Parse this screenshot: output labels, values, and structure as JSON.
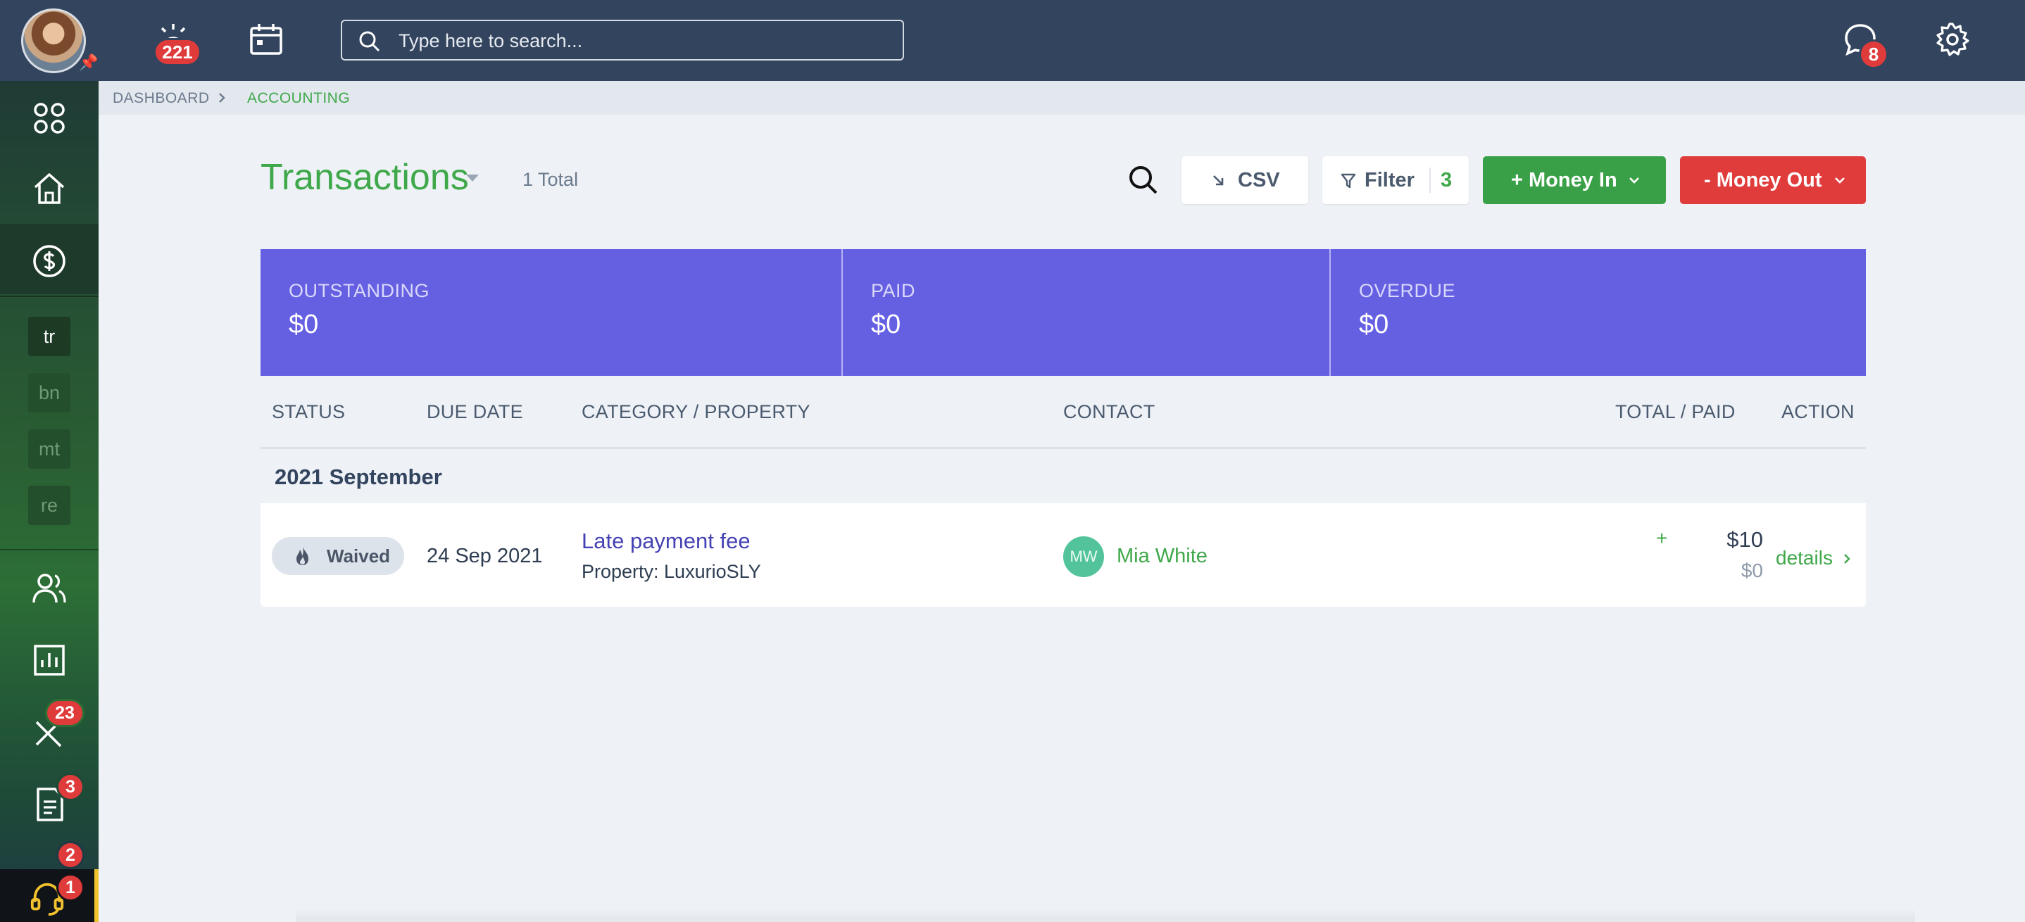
{
  "topbar": {
    "alerts_count": "221",
    "messages_count": "8",
    "search_placeholder": "Type here to search..."
  },
  "sidebar": {
    "mini_items": [
      "tr",
      "bn",
      "mt",
      "re"
    ],
    "maintenance_count": "23",
    "documents_count": "3",
    "extra_count": "2",
    "support_count": "1"
  },
  "breadcrumb": {
    "root": "DASHBOARD",
    "current": "ACCOUNTING"
  },
  "header": {
    "title": "Transactions",
    "total": "1 Total",
    "csv_label": "CSV",
    "filter_label": "Filter",
    "filter_count": "3",
    "money_in_label": "+ Money In",
    "money_out_label": "- Money Out"
  },
  "summary": {
    "outstanding_label": "OUTSTANDING",
    "outstanding_value": "$0",
    "paid_label": "PAID",
    "paid_value": "$0",
    "overdue_label": "OVERDUE",
    "overdue_value": "$0"
  },
  "table": {
    "columns": {
      "status": "STATUS",
      "due_date": "DUE DATE",
      "category": "CATEGORY / PROPERTY",
      "contact": "CONTACT",
      "total": "TOTAL / PAID",
      "action": "ACTION"
    },
    "group": "2021 September",
    "rows": [
      {
        "status": "Waived",
        "due_date": "24 Sep 2021",
        "category": "Late payment fee",
        "property": "Property: LuxurioSLY",
        "contact_initials": "MW",
        "contact_name": "Mia White",
        "total_sign": "+",
        "total": "$10",
        "paid": "$0",
        "action": "details"
      }
    ]
  },
  "colors": {
    "accent_green": "#3fa84a",
    "danger_red": "#e03c3c",
    "summary_purple": "#6560e2",
    "topbar": "#33445e"
  }
}
